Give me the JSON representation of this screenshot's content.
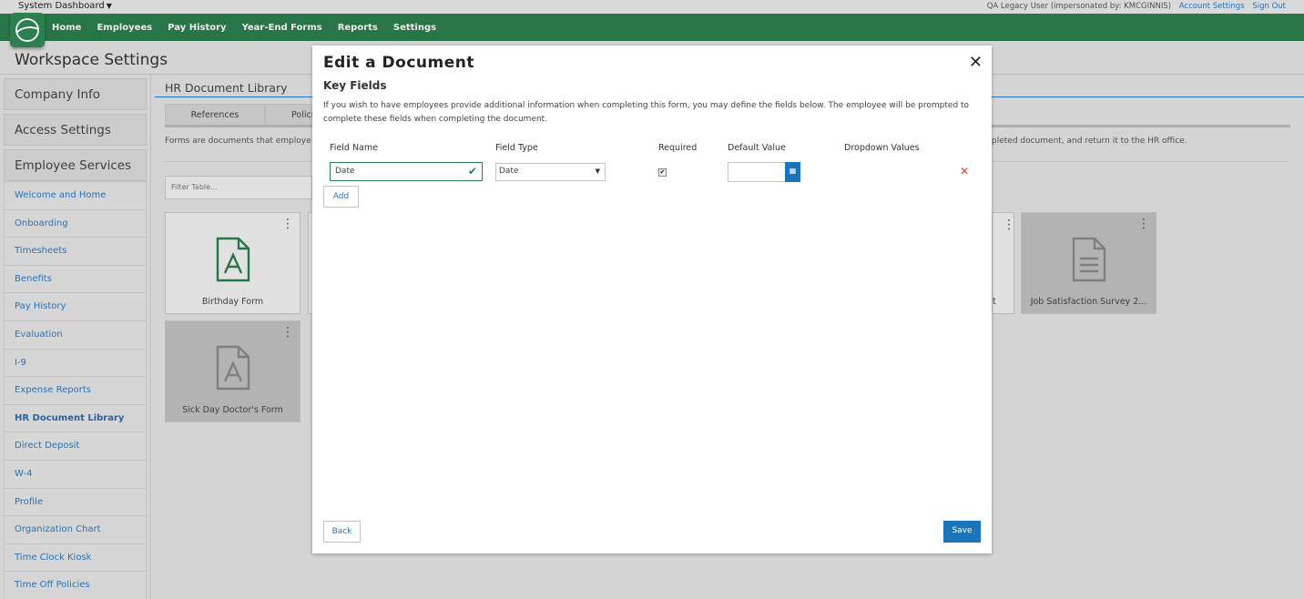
{
  "topbar": {
    "system_dashboard": "System Dashboard",
    "user_info": "QA Legacy User (impersonated by: KMCGINNIS)",
    "account_settings": "Account Settings",
    "sign_out": "Sign Out"
  },
  "nav": {
    "items": [
      "Home",
      "Employees",
      "Pay History",
      "Year-End Forms",
      "Reports",
      "Settings"
    ]
  },
  "page": {
    "title": "Workspace Settings"
  },
  "sidebar": {
    "major": [
      "Company Info",
      "Access Settings",
      "Employee Services"
    ],
    "items": [
      {
        "label": "Welcome and Home"
      },
      {
        "label": "Onboarding"
      },
      {
        "label": "Timesheets"
      },
      {
        "label": "Benefits"
      },
      {
        "label": "Pay History"
      },
      {
        "label": "Evaluation"
      },
      {
        "label": "I-9"
      },
      {
        "label": "Expense Reports"
      },
      {
        "label": "HR Document Library",
        "active": true
      },
      {
        "label": "Direct Deposit"
      },
      {
        "label": "W-4"
      },
      {
        "label": "Profile"
      },
      {
        "label": "Organization Chart"
      },
      {
        "label": "Time Clock Kiosk"
      },
      {
        "label": "Time Off Policies"
      }
    ]
  },
  "main": {
    "section_title": "HR Document Library",
    "tabs": [
      "References",
      "Polici"
    ],
    "description_left": "Forms are documents that employe",
    "description_right": "pleted document, and return it to the HR office.",
    "filter_placeholder": "Filter Table...",
    "cards": [
      {
        "label": "Birthday Form",
        "icon": "pdf-icon"
      },
      {
        "label": "Job Satisfaction Survey 2...",
        "icon": "document-icon"
      },
      {
        "label": "Sick Day Doctor's Form",
        "icon": "pdf-icon"
      }
    ],
    "partial_card_label": "t"
  },
  "modal": {
    "title": "Edit a Document",
    "subtitle": "Key Fields",
    "help_text": "If you wish to have employees provide additional information when completing this form, you may define the fields below. The employee will be prompted to complete these fields when completing the document.",
    "columns": {
      "field_name": "Field Name",
      "field_type": "Field Type",
      "required": "Required",
      "default_value": "Default Value",
      "dropdown_values": "Dropdown Values"
    },
    "row": {
      "field_name": "Date",
      "field_type": "Date",
      "required": true,
      "default_value": ""
    },
    "add_label": "Add",
    "back_label": "Back",
    "save_label": "Save"
  },
  "colors": {
    "nav_green": "#2c7f4f",
    "link_blue": "#2a7bc7",
    "primary_blue": "#1b75bb",
    "remove_red": "#e0453a"
  }
}
